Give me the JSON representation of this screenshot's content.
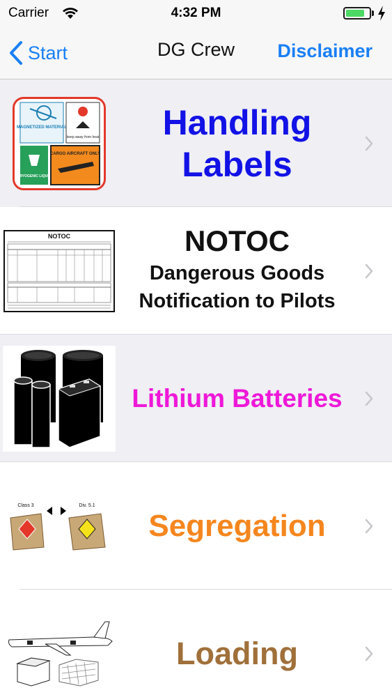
{
  "status_bar": {
    "carrier": "Carrier",
    "time": "4:32 PM",
    "battery_level": 0.8
  },
  "nav": {
    "back_label": "Start",
    "title": "DG Crew",
    "right_label": "Disclaimer"
  },
  "rows": [
    {
      "title_lines": [
        "Handling",
        "Labels"
      ],
      "color": "#1212e6",
      "thumb_icon": "handling-labels-icon",
      "thumb_text": [
        "MAGNETIZED MATERIAL",
        "keep away from heat",
        "CRYOGENIC LIQUID",
        "CARGO AIRCRAFT ONLY"
      ]
    },
    {
      "title": "NOTOC",
      "subtitle_lines": [
        "Dangerous Goods",
        "Notification to Pilots"
      ],
      "color": "#111111",
      "thumb_icon": "notoc-form-icon",
      "thumb_text": "NOTOC"
    },
    {
      "title": "Lithium Batteries",
      "color": "#ee18d8",
      "thumb_icon": "batteries-icon"
    },
    {
      "title": "Segregation",
      "color": "#f5861e",
      "thumb_icon": "segregation-icon",
      "thumb_text": [
        "Class 3",
        "Div. 5.1"
      ]
    },
    {
      "title": "Loading",
      "color": "#a0703a",
      "thumb_icon": "aircraft-loading-icon"
    }
  ]
}
